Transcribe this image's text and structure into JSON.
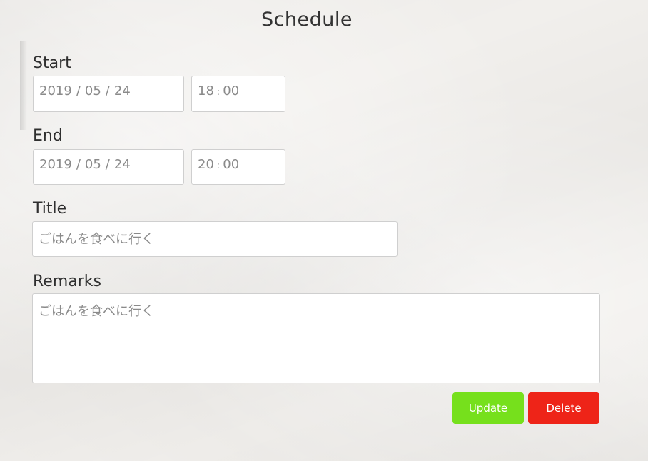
{
  "page": {
    "title": "Schedule"
  },
  "start": {
    "label": "Start",
    "date": {
      "year": "2019",
      "month": "05",
      "day": "24",
      "separator": "/"
    },
    "time": {
      "hour": "18",
      "minute": "00",
      "separator": ":"
    }
  },
  "end": {
    "label": "End",
    "date": {
      "year": "2019",
      "month": "05",
      "day": "24",
      "separator": "/"
    },
    "time": {
      "hour": "20",
      "minute": "00",
      "separator": ":"
    }
  },
  "title_field": {
    "label": "Title",
    "value": "ごはんを食べに行く"
  },
  "remarks_field": {
    "label": "Remarks",
    "value": "ごはんを食べに行く"
  },
  "actions": {
    "update_label": "Update",
    "delete_label": "Delete"
  },
  "colors": {
    "update": "#76e01c",
    "delete": "#ee2418",
    "background": "#f1efec"
  }
}
